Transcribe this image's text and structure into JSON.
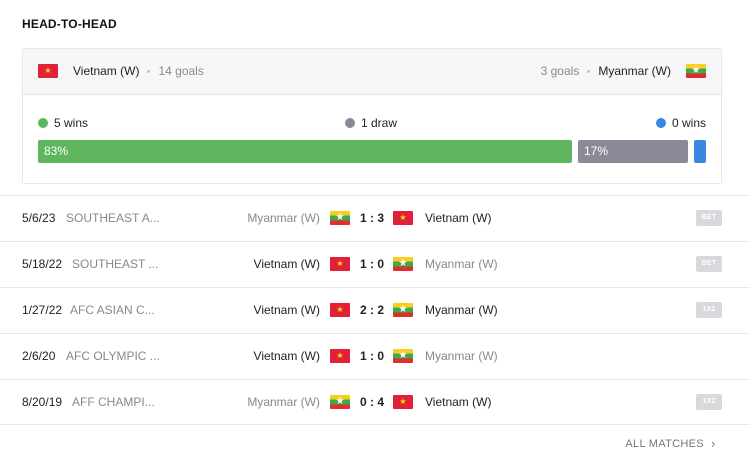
{
  "section_title": "HEAD-TO-HEAD",
  "summary": {
    "team1": {
      "name": "Vietnam (W)",
      "goals": "14 goals",
      "flag": "vietnam-flag"
    },
    "team2": {
      "name": "Myanmar (W)",
      "goals": "3 goals",
      "flag": "myanmar-flag"
    },
    "team1_wins": "5 wins",
    "draws": "1 draw",
    "team2_wins": "0 wins",
    "bar_green_pct": "83%",
    "bar_gray_pct": "17%",
    "colors": {
      "win": "#5fb65f",
      "draw": "#8a8a96",
      "loss": "#3b87e0"
    }
  },
  "matches": [
    {
      "date": "5/6/23",
      "competition": "SOUTHEAST A...",
      "home": "Myanmar (W)",
      "home_flag": "myanmar-flag",
      "score": "1 : 3",
      "away": "Vietnam (W)",
      "away_flag": "vietnam-flag",
      "badge": "BET",
      "home_winner": false
    },
    {
      "date": "5/18/22",
      "competition": "SOUTHEAST ...",
      "home": "Vietnam (W)",
      "home_flag": "vietnam-flag",
      "score": "1 : 0",
      "away": "Myanmar (W)",
      "away_flag": "myanmar-flag",
      "badge": "BET",
      "home_winner": true
    },
    {
      "date": "1/27/22",
      "competition": "AFC ASIAN C...",
      "home": "Vietnam (W)",
      "home_flag": "vietnam-flag",
      "score": "2 : 2",
      "away": "Myanmar (W)",
      "away_flag": "myanmar-flag",
      "badge": "1X2",
      "home_winner": true
    },
    {
      "date": "2/6/20",
      "competition": "AFC OLYMPIC ...",
      "home": "Vietnam (W)",
      "home_flag": "vietnam-flag",
      "score": "1 : 0",
      "away": "Myanmar (W)",
      "away_flag": "myanmar-flag",
      "badge": "",
      "home_winner": true
    },
    {
      "date": "8/20/19",
      "competition": "AFF CHAMPI...",
      "home": "Myanmar (W)",
      "home_flag": "myanmar-flag",
      "score": "0 : 4",
      "away": "Vietnam (W)",
      "away_flag": "vietnam-flag",
      "badge": "1X2",
      "home_winner": false
    }
  ],
  "footer": {
    "all_matches_label": "ALL MATCHES"
  }
}
